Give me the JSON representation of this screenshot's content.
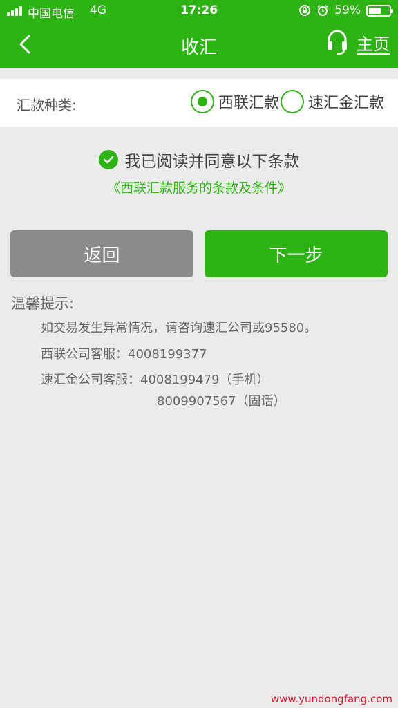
{
  "status_bar": {
    "carrier": "中国电信",
    "network": "4G",
    "time": "17:26",
    "battery_percent": "59%",
    "battery_level": 0.59,
    "icons": [
      "signal-icon",
      "orientation-lock-icon",
      "alarm-icon",
      "battery-icon"
    ]
  },
  "nav": {
    "back_icon": "chevron-left-icon",
    "title": "收汇",
    "home_icon": "headset-icon",
    "home_label": "主页"
  },
  "remit_type": {
    "label": "汇款种类:",
    "options": [
      {
        "label": "西联汇款",
        "selected": true
      },
      {
        "label": "速汇金汇款",
        "selected": false
      }
    ]
  },
  "agreement": {
    "checked": true,
    "text": "我已阅读并同意以下条款",
    "terms_link": "《西联汇款服务的条款及条件》"
  },
  "buttons": {
    "back_label": "返回",
    "next_label": "下一步"
  },
  "tips": {
    "title": "温馨提示:",
    "line1": "如交易发生异常情况，请咨询速汇公司或95580。",
    "line2": "西联公司客服：4008199377",
    "line3": "速汇金公司客服：4008199479（手机）",
    "line4": "8009907567（固话）"
  },
  "watermark": "www.yundongfang.com",
  "colors": {
    "brand_green": "#2eb314",
    "back_button_gray": "#8b8b8b",
    "page_bg": "#ebebeb"
  }
}
